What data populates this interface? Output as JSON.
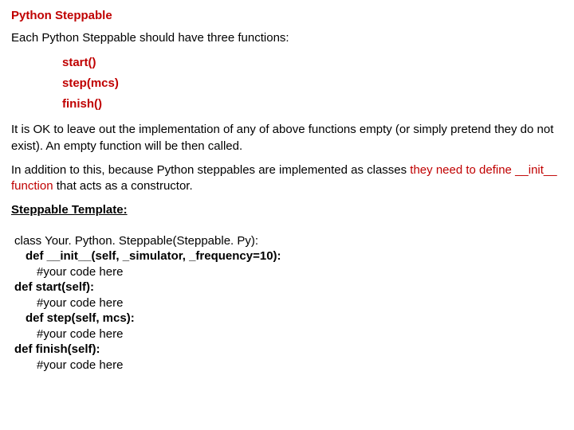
{
  "title": "Python Steppable",
  "intro": "Each Python Steppable should have three functions:",
  "funcs": [
    "start()",
    "step(mcs)",
    "finish()"
  ],
  "para2": "It is OK to leave out the implementation of any of above functions empty (or simply pretend they do not exist). An empty function will be then called.",
  "para3_a": "In addition to this, because Python steppables are implemented as classes ",
  "para3_b": "they need to define __init__ function",
  "para3_c": " that acts as a constructor.",
  "subheading": "Steppable Template:",
  "code": {
    "l1": "class Your. Python. Steppable(Steppable. Py):",
    "l2": "def __init__(self, _simulator, _frequency=10):",
    "l3": "#your code here",
    "l4": "def start(self):",
    "l5": "#your code here",
    "l6": "def step(self, mcs):",
    "l7": "#your code here",
    "l8": "def finish(self):",
    "l9": "#your code here"
  }
}
